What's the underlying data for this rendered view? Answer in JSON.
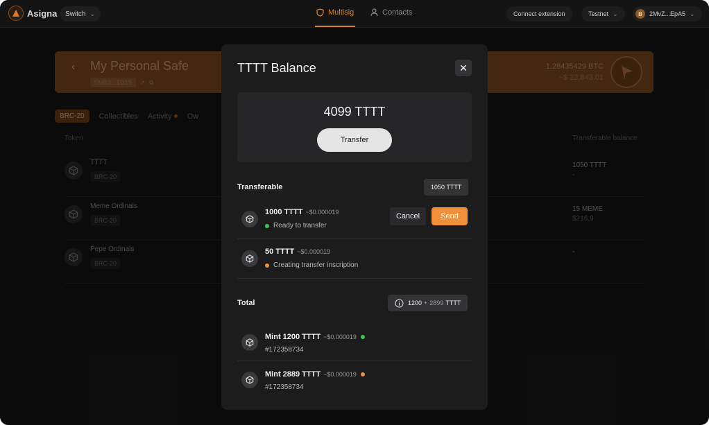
{
  "colors": {
    "accent": "#d9822b",
    "send": "#f0903a",
    "ready": "#3ec45a",
    "pending": "#f0903a"
  },
  "topbar": {
    "logo_text": "Asigna",
    "switch_label": "Switch",
    "nav": [
      {
        "label": "Multisig",
        "icon": "shield-icon",
        "active": true
      },
      {
        "label": "Contacts",
        "icon": "user-icon",
        "active": false
      }
    ],
    "connect_label": "Connect extension",
    "network_label": "Testnet",
    "account_label": "2MvZ...EpA5",
    "account_badge": "B"
  },
  "safe": {
    "title": "My Personal Safe",
    "address": "SMBS...1D1S",
    "btc_balance": "1.28435429 BTC",
    "usd_balance": "~$ 32,843.01"
  },
  "tabs": [
    {
      "label": "BRC-20",
      "active": true
    },
    {
      "label": "Collectibles",
      "active": false
    },
    {
      "label": "Activity",
      "active": false,
      "dot": true
    },
    {
      "label": "Ow",
      "active": false
    }
  ],
  "table": {
    "headers": {
      "token": "Token",
      "transferable": "Transferable balance"
    },
    "rows": [
      {
        "name": "TTTT",
        "tag": "BRC-20",
        "balance": "1050 TTTT",
        "balance_sub": "-"
      },
      {
        "name": "Meme Ordinals",
        "tag": "BRC-20",
        "balance": "15 MEME",
        "balance_sub": "$216,9"
      },
      {
        "name": "Pepe Ordinals",
        "tag": "BRC-20",
        "balance": "-",
        "balance_sub": ""
      }
    ]
  },
  "modal": {
    "title": "TTTT Balance",
    "balance": "4099 TTTT",
    "transfer_label": "Transfer",
    "transferable_label": "Transferable",
    "transferable_amount": "1050 TTTT",
    "transferable_items": [
      {
        "title": "1000 TTTT",
        "fee": "~$0.000019",
        "status": "Ready to transfer",
        "state": "ready"
      },
      {
        "title": "50 TTTT",
        "fee": "~$0.000019",
        "status": "Creating transfer inscription",
        "state": "pending"
      }
    ],
    "cancel_label": "Cancel",
    "send_label": "Send",
    "total_label": "Total",
    "total_a": "1200",
    "total_plus": "+",
    "total_b": "2899",
    "total_unit": "TTTT",
    "mint_items": [
      {
        "title": "Mint 1200 TTTT",
        "fee": "~$0.000019",
        "id": "#172358734",
        "state": "ready"
      },
      {
        "title": "Mint 2889 TTTT",
        "fee": "~$0.000019",
        "id": "#172358734",
        "state": "pending"
      }
    ]
  }
}
